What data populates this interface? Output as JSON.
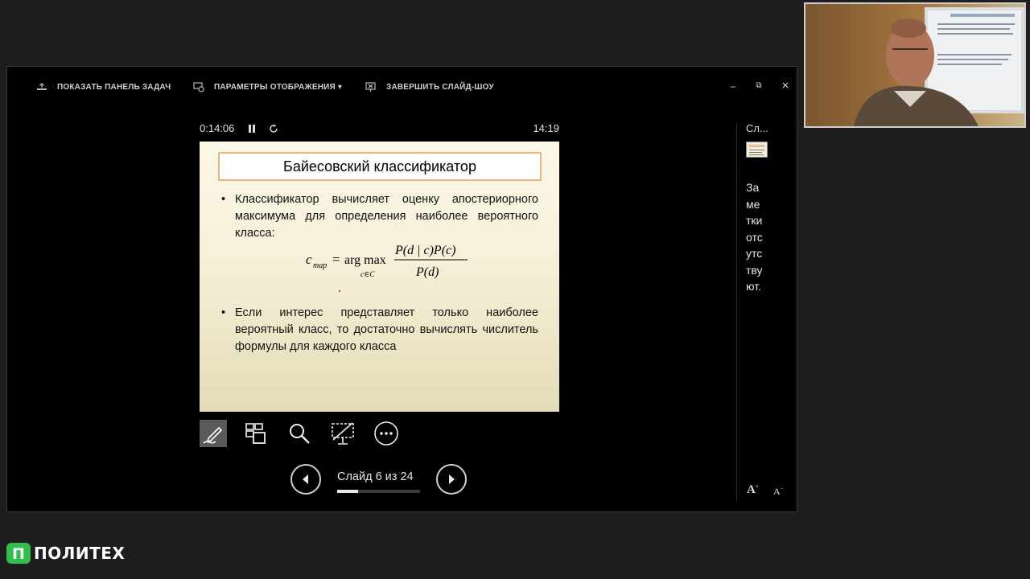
{
  "toolbar": {
    "show_taskbar": "ПОКАЗАТЬ ПАНЕЛЬ ЗАДАЧ",
    "display_settings": "ПАРАМЕТРЫ ОТОБРАЖЕНИЯ ▾",
    "end_slideshow": "ЗАВЕРШИТЬ СЛАЙД-ШОУ",
    "window_controls": {
      "minimize": "–",
      "restore": "⧉",
      "close": "×"
    }
  },
  "timer": {
    "elapsed": "0:14:06",
    "clock": "14:19",
    "pause_icon": "pause-icon",
    "restart_icon": "restart-icon"
  },
  "slide": {
    "title": "Байесовский классификатор",
    "bullet1": "Классификатор вычисляет оценку апостериорного максимума для определения наиболее вероятного класса:",
    "bullet2": "Если интерес представляет только наиболее вероятный класс, то достаточно вычислять числитель формулы для каждого класса",
    "formula": {
      "lhs": "c",
      "lhs_sub": "map",
      "eq": "=",
      "argmax": "arg max",
      "argmax_sub": "c∈C",
      "numerator": "P(d | c)P(c)",
      "denominator": "P(d)"
    },
    "background_colors": [
      "#fbf8e8",
      "#e4dcb6"
    ],
    "title_border_color": "#f2b27a"
  },
  "tools": [
    "pen-tool-icon",
    "see-all-slides-icon",
    "zoom-icon",
    "black-screen-icon",
    "more-options-icon"
  ],
  "navigation": {
    "counter": "Слайд 6 из 24",
    "current": 6,
    "total": 24,
    "progress": 0.25
  },
  "notes": {
    "header": "Сл...",
    "text": "Заметки отсутствуют.",
    "increase_font": "A",
    "decrease_font": "A"
  },
  "logo": {
    "text": "ПОЛИТЕХ",
    "mark": "П",
    "color": "#2fbf4a"
  }
}
